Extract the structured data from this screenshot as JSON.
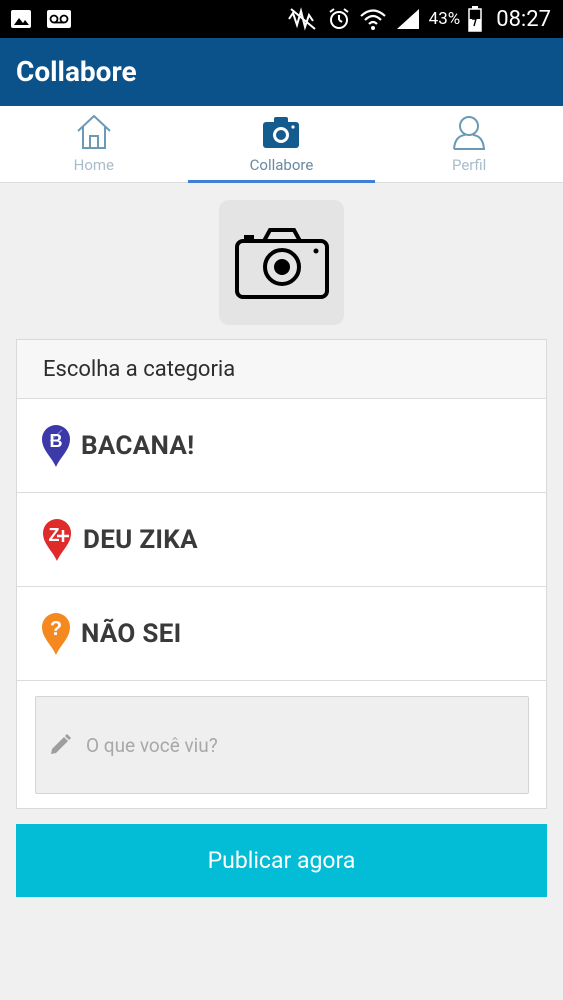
{
  "status_bar": {
    "battery_percent": "43%",
    "time": "08:27",
    "icons": [
      "image-icon",
      "voicemail-icon",
      "mute-icon",
      "alarm-icon",
      "wifi-icon",
      "signal-icon",
      "battery-icon"
    ]
  },
  "appbar": {
    "title": "Collabore"
  },
  "tabs": [
    {
      "label": "Home",
      "icon": "home-icon",
      "active": false
    },
    {
      "label": "Collabore",
      "icon": "camera-icon",
      "active": true
    },
    {
      "label": "Perfil",
      "icon": "user-icon",
      "active": false
    }
  ],
  "camera": {
    "icon": "camera-icon"
  },
  "category_card": {
    "header": "Escolha a categoria",
    "items": [
      {
        "label": "BACANA!",
        "icon": "pin-b-icon",
        "color": "#3b3aa8"
      },
      {
        "label": "DEU ZIKA",
        "icon": "pin-z-icon",
        "color": "#e02b2b"
      },
      {
        "label": "NÃO SEI",
        "icon": "pin-question-icon",
        "color": "#f5891f"
      }
    ]
  },
  "comment_input": {
    "placeholder": "O que você viu?",
    "value": "",
    "icon": "pencil-icon"
  },
  "publish_button": {
    "label": "Publicar agora",
    "color": "#03bcd6"
  },
  "colors": {
    "appbar": "#0a5289",
    "tab_indicator": "#3f7fd6",
    "background": "#f0f0f0"
  }
}
